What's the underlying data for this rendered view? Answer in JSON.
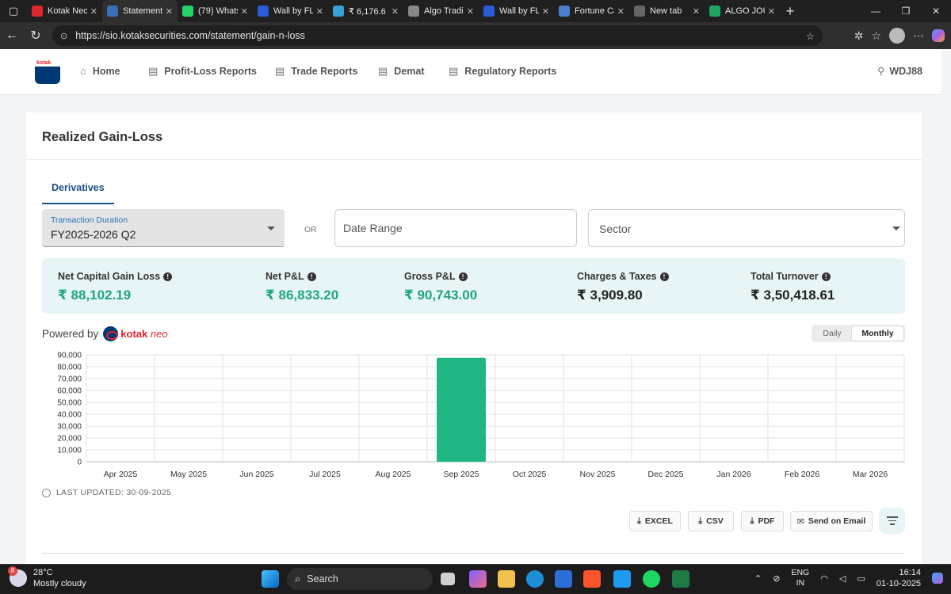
{
  "browser": {
    "tabs": [
      {
        "label": "Kotak Neo",
        "color": "#e0262e",
        "active": false
      },
      {
        "label": "Statement",
        "color": "#3b6fb6",
        "active": true
      },
      {
        "label": "(79) Whats",
        "color": "#25d366",
        "active": false
      },
      {
        "label": "Wall by FL",
        "color": "#2a5cd6",
        "active": false
      },
      {
        "label": "₹ 6,176.6 |",
        "color": "#3aa0d8",
        "active": false
      },
      {
        "label": "Algo Tradi",
        "color": "#888888",
        "active": false
      },
      {
        "label": "Wall by FL",
        "color": "#2a5cd6",
        "active": false
      },
      {
        "label": "Fortune Ca",
        "color": "#4a7fd0",
        "active": false
      },
      {
        "label": "New tab",
        "color": "#666666",
        "active": false
      },
      {
        "label": "ALGO JOU",
        "color": "#1fa463",
        "active": false
      }
    ],
    "url": "https://sio.kotaksecurities.com/statement/gain-n-loss"
  },
  "nav": {
    "logo_text": "kotak",
    "items": [
      "Home",
      "Profit-Loss Reports",
      "Trade Reports",
      "Demat",
      "Regulatory Reports"
    ],
    "user": "WDJ88"
  },
  "card": {
    "title": "Realized Gain-Loss",
    "tab": "Derivatives",
    "duration_label": "Transaction Duration",
    "duration_value": "FY2025-2026 Q2",
    "or_text": "OR",
    "date_range_placeholder": "Date Range",
    "sector_placeholder": "Sector"
  },
  "summary": [
    {
      "label": "Net Capital Gain Loss",
      "value": "₹ 88,102.19",
      "tone": "green"
    },
    {
      "label": "Net P&L",
      "value": "₹ 86,833.20",
      "tone": "green"
    },
    {
      "label": "Gross P&L",
      "value": "₹ 90,743.00",
      "tone": "green"
    },
    {
      "label": "Charges & Taxes",
      "value": "₹ 3,909.80",
      "tone": "dark"
    },
    {
      "label": "Total Turnover",
      "value": "₹ 3,50,418.61",
      "tone": "dark"
    }
  ],
  "powered_by": "Powered by",
  "brand": {
    "kotak": "kotak",
    "neo": "neo"
  },
  "toggle": {
    "daily": "Daily",
    "monthly": "Monthly",
    "selected": "Monthly"
  },
  "chart_data": {
    "type": "bar",
    "categories": [
      "Apr 2025",
      "May 2025",
      "Jun 2025",
      "Jul 2025",
      "Aug 2025",
      "Sep 2025",
      "Oct 2025",
      "Nov 2025",
      "Dec 2025",
      "Jan 2026",
      "Feb 2026",
      "Mar 2026"
    ],
    "values": [
      0,
      0,
      0,
      0,
      0,
      87500,
      0,
      0,
      0,
      0,
      0,
      0
    ],
    "ylim": [
      0,
      90000
    ],
    "yticks": [
      "0",
      "10,000",
      "20,000",
      "30,000",
      "40,000",
      "50,000",
      "60,000",
      "70,000",
      "80,000",
      "90,000"
    ],
    "bar_color": "#1fb584",
    "grid": true
  },
  "last_updated": "LAST UPDATED: 30-09-2025",
  "actions": [
    "EXCEL",
    "CSV",
    "PDF",
    "Send on Email"
  ],
  "taskbar": {
    "temp": "28°C",
    "weather": "Mostly cloudy",
    "badge": "8",
    "search": "Search",
    "lang1": "ENG",
    "lang2": "IN",
    "time": "16:14",
    "date": "01-10-2025"
  }
}
